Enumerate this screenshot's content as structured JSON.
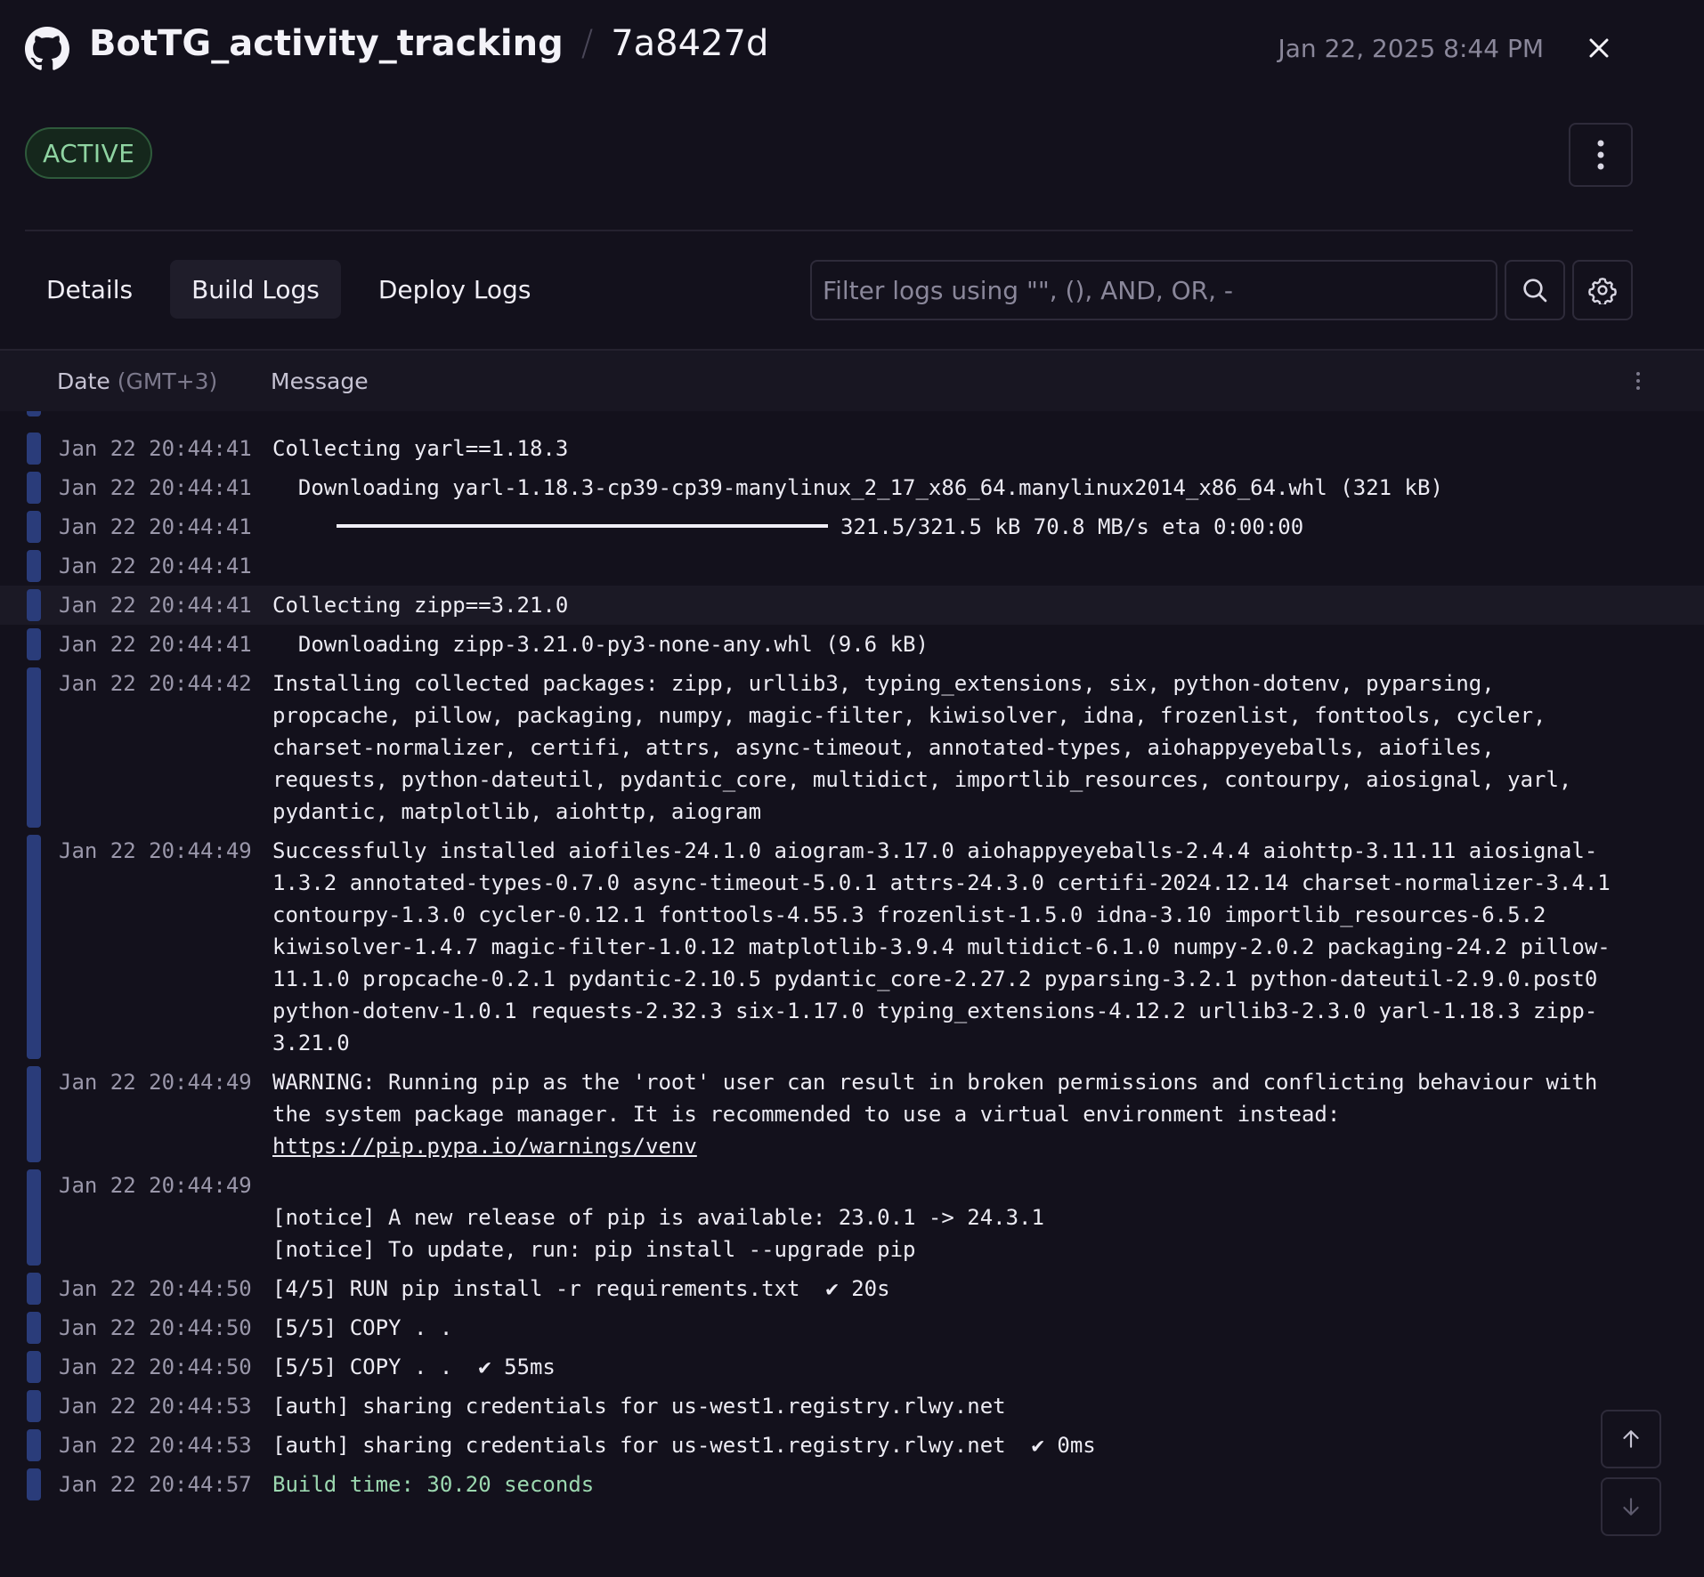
{
  "header": {
    "repo": "BotTG_activity_tracking",
    "separator": "/",
    "commit": "7a8427d",
    "timestamp": "Jan 22, 2025 8:44 PM"
  },
  "status": {
    "badge": "ACTIVE"
  },
  "tabs": [
    {
      "label": "Details"
    },
    {
      "label": "Build Logs"
    },
    {
      "label": "Deploy Logs"
    }
  ],
  "filter": {
    "placeholder": "Filter logs using \"\", (), AND, OR, -"
  },
  "table": {
    "date_label": "Date",
    "tz_label": "(GMT+3)",
    "message_label": "Message"
  },
  "logs": [
    {
      "time": "Jan 22 20:44:41",
      "message": "Collecting yarl==1.18.3"
    },
    {
      "time": "Jan 22 20:44:41",
      "message": "  Downloading yarl-1.18.3-cp39-cp39-manylinux_2_17_x86_64.manylinux2014_x86_64.whl (321 kB)"
    },
    {
      "time": "Jan 22 20:44:41",
      "progress_text": "321.5/321.5 kB 70.8 MB/s eta 0:00:00"
    },
    {
      "time": "Jan 22 20:44:41",
      "message": ""
    },
    {
      "time": "Jan 22 20:44:41",
      "message": "Collecting zipp==3.21.0"
    },
    {
      "time": "Jan 22 20:44:41",
      "message": "  Downloading zipp-3.21.0-py3-none-any.whl (9.6 kB)"
    },
    {
      "time": "Jan 22 20:44:42",
      "message": "Installing collected packages: zipp, urllib3, typing_extensions, six, python-dotenv, pyparsing,\npropcache, pillow, packaging, numpy, magic-filter, kiwisolver, idna, frozenlist, fonttools, cycler,\ncharset-normalizer, certifi, attrs, async-timeout, annotated-types, aiohappyeyeballs, aiofiles,\nrequests, python-dateutil, pydantic_core, multidict, importlib_resources, contourpy, aiosignal, yarl,\npydantic, matplotlib, aiohttp, aiogram"
    },
    {
      "time": "Jan 22 20:44:49",
      "message": "Successfully installed aiofiles-24.1.0 aiogram-3.17.0 aiohappyeyeballs-2.4.4 aiohttp-3.11.11 aiosignal-\n1.3.2 annotated-types-0.7.0 async-timeout-5.0.1 attrs-24.3.0 certifi-2024.12.14 charset-normalizer-3.4.1\ncontourpy-1.3.0 cycler-0.12.1 fonttools-4.55.3 frozenlist-1.5.0 idna-3.10 importlib_resources-6.5.2\nkiwisolver-1.4.7 magic-filter-1.0.12 matplotlib-3.9.4 multidict-6.1.0 numpy-2.0.2 packaging-24.2 pillow-\n11.1.0 propcache-0.2.1 pydantic-2.10.5 pydantic_core-2.27.2 pyparsing-3.2.1 python-dateutil-2.9.0.post0\npython-dotenv-1.0.1 requests-2.32.3 six-1.17.0 typing_extensions-4.12.2 urllib3-2.3.0 yarl-1.18.3 zipp-\n3.21.0"
    },
    {
      "time": "Jan 22 20:44:49",
      "message": "WARNING: Running pip as the 'root' user can result in broken permissions and conflicting behaviour with\nthe system package manager. It is recommended to use a virtual environment instead:",
      "link": "https://pip.pypa.io/warnings/venv"
    },
    {
      "time": "Jan 22 20:44:49",
      "message": "\n[notice] A new release of pip is available: 23.0.1 -> 24.3.1\n[notice] To update, run: pip install --upgrade pip"
    },
    {
      "time": "Jan 22 20:44:50",
      "message": "[4/5] RUN pip install -r requirements.txt  ✔ 20s"
    },
    {
      "time": "Jan 22 20:44:50",
      "message": "[5/5] COPY . ."
    },
    {
      "time": "Jan 22 20:44:50",
      "message": "[5/5] COPY . .  ✔ 55ms"
    },
    {
      "time": "Jan 22 20:44:53",
      "message": "[auth] sharing credentials for us-west1.registry.rlwy.net"
    },
    {
      "time": "Jan 22 20:44:53",
      "message": "[auth] sharing credentials for us-west1.registry.rlwy.net  ✔ 0ms"
    },
    {
      "time": "Jan 22 20:44:57",
      "message": "Build time: 30.20 seconds",
      "style": "green"
    }
  ],
  "colors": {
    "background": "#13111c",
    "log_bar": "#2a3c7a",
    "badge_text": "#8fd4a2",
    "success_text": "#9cd8b0"
  },
  "icons": {
    "header": "github-icon",
    "close": "close-icon",
    "menu": "vertical-dots-icon",
    "search": "search-icon",
    "settings": "gear-icon",
    "scroll_up": "arrow-up-icon",
    "scroll_down": "arrow-down-icon"
  }
}
